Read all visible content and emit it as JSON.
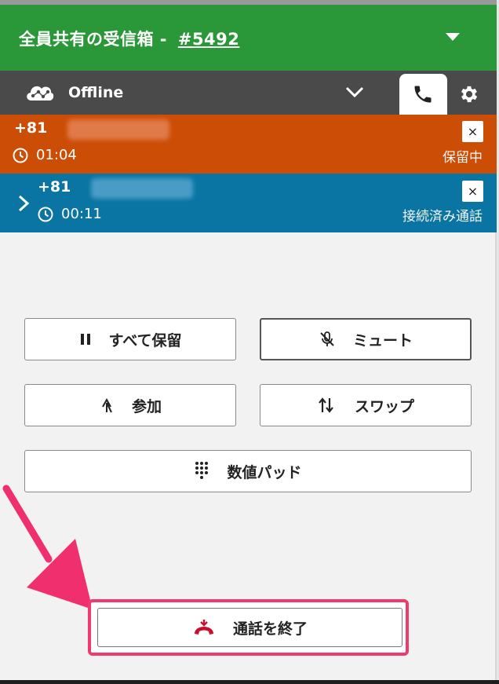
{
  "header": {
    "title": "全員共有の受信箱 - ",
    "number": "#5492"
  },
  "status": {
    "label": "Offline"
  },
  "calls": [
    {
      "country_code": "+81",
      "time": "01:04",
      "state": "保留中",
      "close": "×",
      "color": "#cc4d06"
    },
    {
      "country_code": "+81",
      "time": "00:11",
      "state": "接続済み通話",
      "close": "×",
      "color": "#0a74a3"
    }
  ],
  "actions": {
    "hold_all": "すべて保留",
    "mute": "ミュート",
    "join": "参加",
    "swap": "スワップ",
    "keypad": "数値パッド",
    "end_call": "通話を終了"
  },
  "colors": {
    "header": "#2a9738",
    "accent_highlight": "#ef3a6e",
    "end_icon": "#c8102e"
  }
}
